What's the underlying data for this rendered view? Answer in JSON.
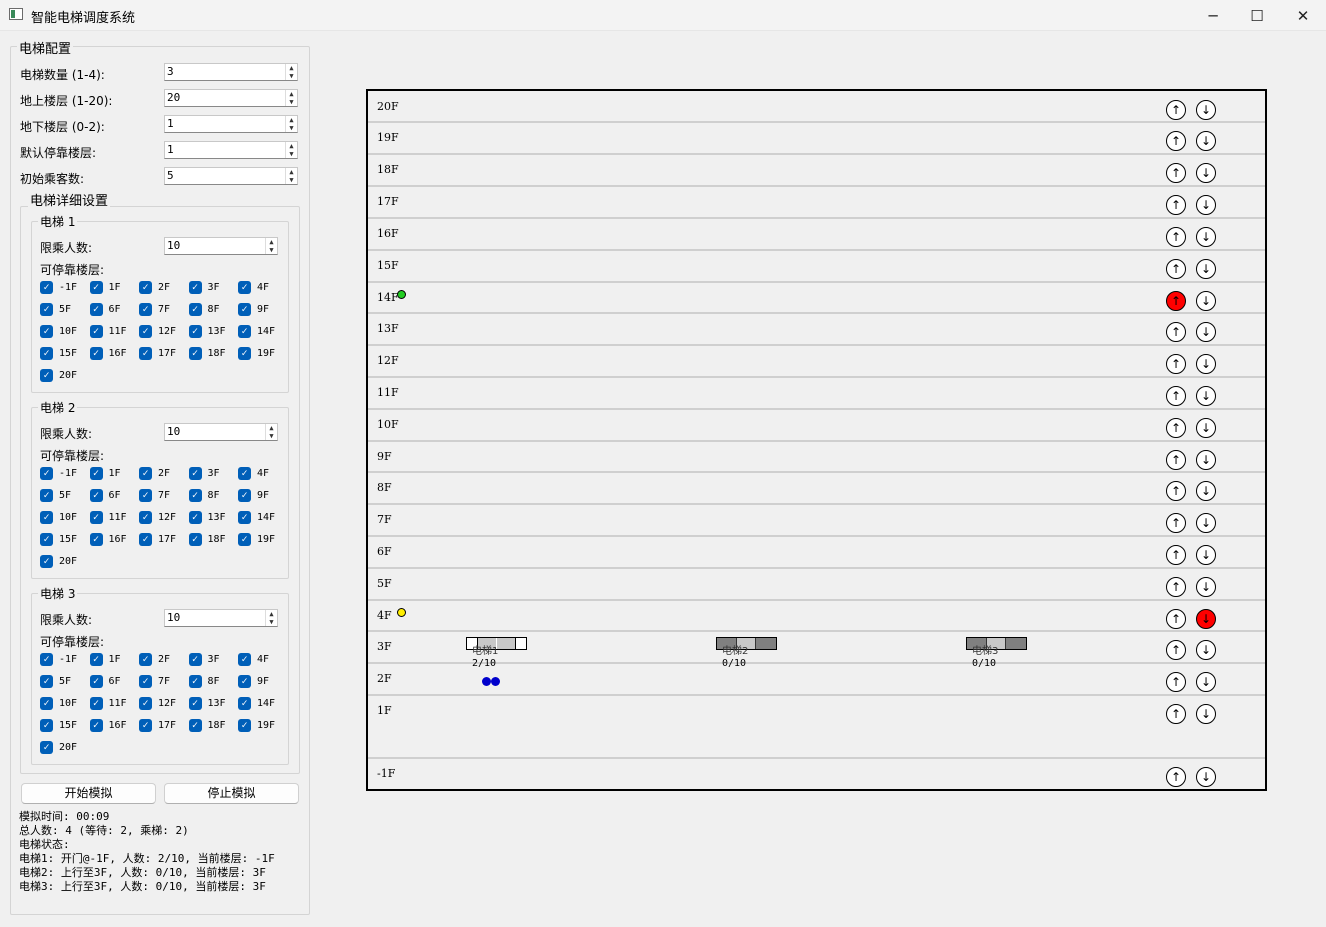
{
  "window": {
    "title": "智能电梯调度系统",
    "minimize": "─",
    "maximize": "☐",
    "close": "✕"
  },
  "config": {
    "group_title": "电梯配置",
    "rows": [
      {
        "label": "电梯数量 (1-4):",
        "value": "3"
      },
      {
        "label": "地上楼层 (1-20):",
        "value": "20"
      },
      {
        "label": "地下楼层 (0-2):",
        "value": "1"
      },
      {
        "label": "默认停靠楼层:",
        "value": "1"
      },
      {
        "label": "初始乘客数:",
        "value": "5"
      }
    ],
    "detail_title": "电梯详细设置",
    "capacity_label": "限乘人数:",
    "floors_label": "可停靠楼层:",
    "elevators": [
      {
        "title": "电梯 1",
        "capacity": "10"
      },
      {
        "title": "电梯 2",
        "capacity": "10"
      },
      {
        "title": "电梯 3",
        "capacity": "10"
      }
    ],
    "floor_options": [
      "-1F",
      "1F",
      "2F",
      "3F",
      "4F",
      "5F",
      "6F",
      "7F",
      "8F",
      "9F",
      "10F",
      "11F",
      "12F",
      "13F",
      "14F",
      "15F",
      "16F",
      "17F",
      "18F",
      "19F",
      "20F"
    ],
    "checkmark": "✓"
  },
  "buttons": {
    "start": "开始模拟",
    "stop": "停止模拟"
  },
  "status": {
    "time": "模拟时间: 00:09",
    "total": "总人数: 4 (等待: 2, 乘梯: 2)",
    "header": "电梯状态:",
    "lines": [
      "电梯1: 开门@-1F, 人数: 2/10, 当前楼层: -1F",
      "电梯2: 上行至3F, 人数: 0/10, 当前楼层: 3F",
      "电梯3: 上行至3F, 人数: 0/10, 当前楼层: 3F"
    ]
  },
  "building": {
    "floors": [
      "20F",
      "19F",
      "18F",
      "17F",
      "16F",
      "15F",
      "14F",
      "13F",
      "12F",
      "11F",
      "10F",
      "9F",
      "8F",
      "7F",
      "6F",
      "5F",
      "4F",
      "3F",
      "2F",
      "1F",
      "-1F"
    ],
    "up_arrow": "↑",
    "down_arrow": "↓",
    "lit_up_floors": [
      "14F"
    ],
    "lit_down_floors": [
      "4F"
    ],
    "cars": [
      {
        "label": "电梯1",
        "load": "2/10",
        "open": true
      },
      {
        "label": "电梯2",
        "load": "0/10",
        "open": false
      },
      {
        "label": "电梯3",
        "load": "0/10",
        "open": false
      }
    ],
    "colors": {
      "lit": "#ff0000",
      "car_closed": "#808080",
      "car_open": "#c8c8c8",
      "person_riding": "#0000cc",
      "waiting_up": "#22cc22",
      "waiting_down": "#ffee00"
    }
  }
}
